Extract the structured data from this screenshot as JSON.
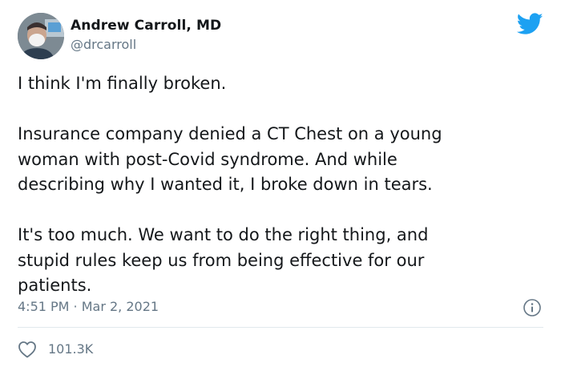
{
  "author": {
    "display_name": "Andrew Carroll, MD",
    "handle": "@drcarroll"
  },
  "tweet": {
    "paragraphs": [
      [
        "I think I'm finally broken."
      ],
      [
        "Insurance company denied a CT Chest on a young",
        "woman with post-Covid syndrome. And while",
        "describing why I wanted it, I broke down in tears."
      ],
      [
        "It's too much. We want to do the right thing, and",
        "stupid rules keep us from being effective for our",
        "patients."
      ]
    ],
    "timestamp": "4:51 PM · Mar 2, 2021"
  },
  "engagement": {
    "likes": "101.3K"
  },
  "colors": {
    "twitter_blue": "#1da1f2",
    "secondary_text": "#657786",
    "divider": "#e1e8ed"
  },
  "icons": {
    "logo": "twitter-bird-icon",
    "info": "info-icon",
    "like": "heart-icon"
  }
}
